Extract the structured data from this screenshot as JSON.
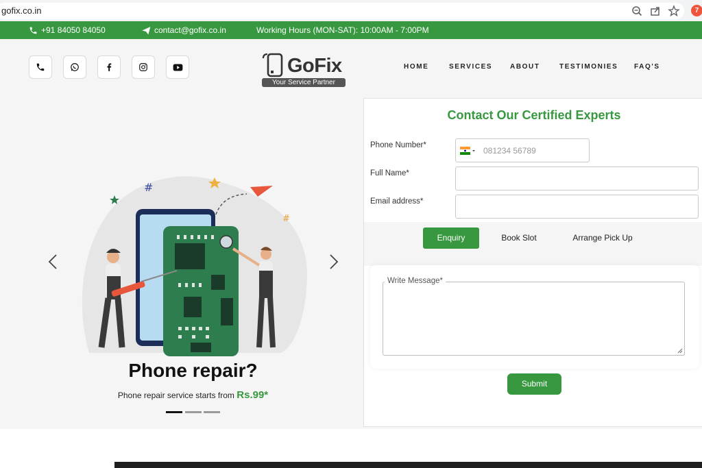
{
  "browser": {
    "url": "gofix.co.in",
    "extension_initial": "7"
  },
  "topbar": {
    "phone": "+91 84050 84050",
    "email": "contact@gofix.co.in",
    "hours": "Working Hours (MON-SAT): 10:00AM - 7:00PM",
    "color": "#37983f"
  },
  "header": {
    "social_icons": [
      "phone-icon",
      "whatsapp-icon",
      "facebook-icon",
      "instagram-icon",
      "youtube-icon"
    ],
    "logo": {
      "name": "GoFix",
      "tagline": "Your Service Partner"
    },
    "nav": [
      "HOME",
      "SERVICES",
      "ABOUT",
      "TESTIMONIES",
      "FAQ'S"
    ]
  },
  "hero": {
    "title": "Phone repair?",
    "subtitle": "Phone repair service starts from",
    "price": "Rs.99*",
    "slides": 3,
    "active_slide": 1
  },
  "form": {
    "title": "Contact Our Certified Experts",
    "phone_label": "Phone Number*",
    "phone_placeholder": "081234 56789",
    "name_label": "Full Name*",
    "email_label": "Email address*",
    "tabs": [
      "Enquiry",
      "Book Slot",
      "Arrange Pick Up"
    ],
    "active_tab": "Enquiry",
    "message_label": "Write Message*",
    "submit_label": "Submit"
  }
}
